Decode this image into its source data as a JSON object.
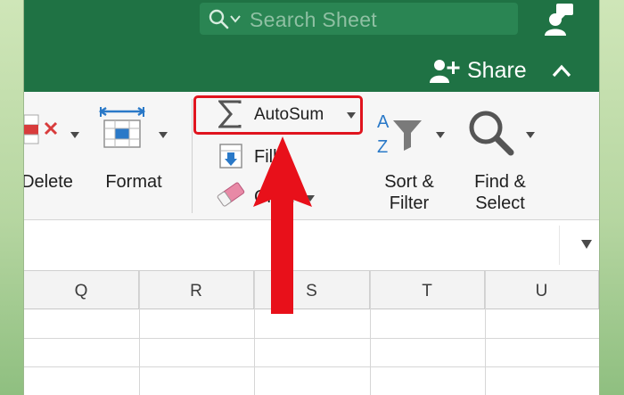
{
  "search": {
    "placeholder": "Search Sheet"
  },
  "share": {
    "label": "Share"
  },
  "ribbon": {
    "delete_label": "Delete",
    "format_label": "Format",
    "autosum_label": "AutoSum",
    "fill_label": "Fill",
    "clear_label": "Clear",
    "sort_filter_line1": "Sort &",
    "sort_filter_line2": "Filter",
    "find_select_line1": "Find &",
    "find_select_line2": "Select"
  },
  "columns": [
    "Q",
    "R",
    "S",
    "T",
    "U"
  ],
  "colors": {
    "title_bar": "#1f7244",
    "highlight": "#e0141e",
    "arrow": "#e8101a"
  }
}
